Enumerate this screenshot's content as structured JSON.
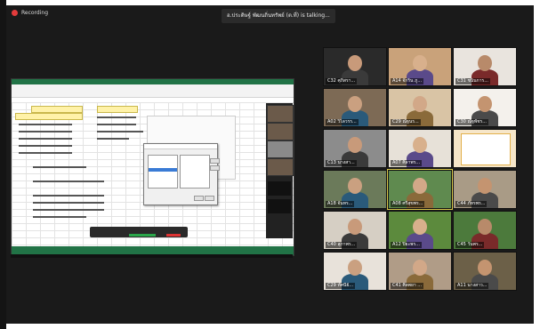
{
  "recording": {
    "label": "Recording"
  },
  "speaker_banner": {
    "text": "อ.ประดิษฐ์  พัฒนถิ่นทรัพย์ (ต.ที่) is  talking..."
  },
  "participants": [
    {
      "name": "C32 ศุภิสรา..."
    },
    {
      "name": "A14 จักริน ภู..."
    },
    {
      "name": "C31 ชนินการ..."
    },
    {
      "name": "A02 วิไลวรร..."
    },
    {
      "name": "C29 ณัฐนร..."
    },
    {
      "name": "C30 ณัฐพัชร..."
    },
    {
      "name": "C13 นางสา..."
    },
    {
      "name": "A07 ศิลาพร..."
    },
    {
      "name": ""
    },
    {
      "name": "A18 จันทร..."
    },
    {
      "name": "A08 ศรีสุขพร..."
    },
    {
      "name": "C44 ภัทรพร..."
    },
    {
      "name": "C40 สุภาพร..."
    },
    {
      "name": "A12 ปิยะพร..."
    },
    {
      "name": "C45 วันพร..."
    },
    {
      "name": "C29 ทัศนีย์..."
    },
    {
      "name": "C41 ศิลพยา ..."
    },
    {
      "name": "A11 นางสาว..."
    }
  ],
  "colors": {
    "screen_bg": "#1a1a1a",
    "excel_green": "#217346",
    "rec_red": "#e23b3b",
    "active_border": "#d7c64a"
  }
}
